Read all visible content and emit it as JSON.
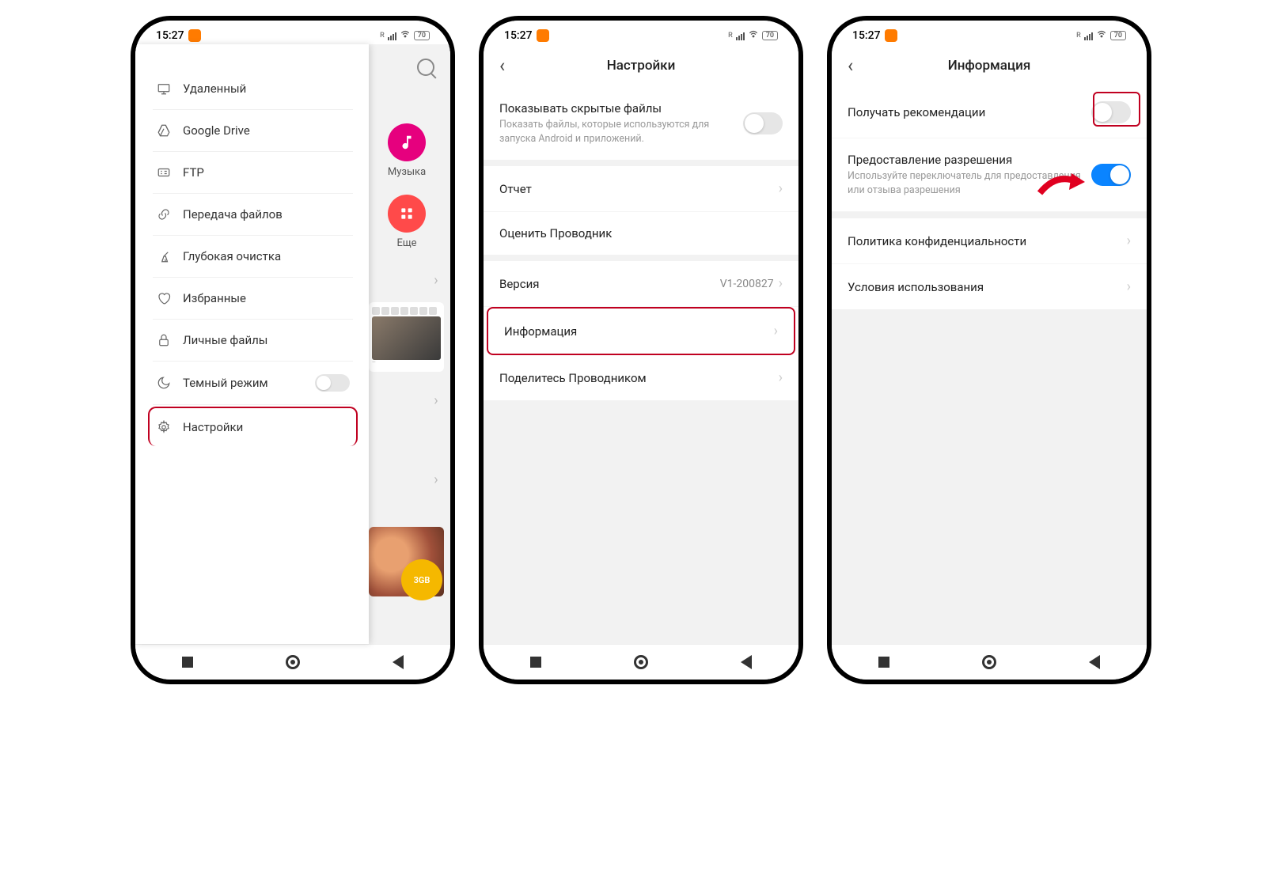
{
  "status": {
    "time": "15:27",
    "battery": "70"
  },
  "phone1": {
    "drawer": {
      "remote": "Удаленный",
      "gdrive": "Google Drive",
      "ftp": "FTP",
      "transfer": "Передача файлов",
      "clean": "Глубокая очистка",
      "favorites": "Избранные",
      "private": "Личные файлы",
      "dark": "Темный режим",
      "settings": "Настройки"
    },
    "tiles": {
      "music": "Музыка",
      "more": "Еще"
    },
    "fab": "3GB"
  },
  "phone2": {
    "title": "Настройки",
    "hidden": {
      "title": "Показывать скрытые файлы",
      "sub": "Показать файлы, которые используются для запуска Android и приложений."
    },
    "report": "Отчет",
    "rate": "Оценить Проводник",
    "version": {
      "label": "Версия",
      "value": "V1-200827"
    },
    "info": "Информация",
    "share": "Поделитесь Проводником"
  },
  "phone3": {
    "title": "Информация",
    "rec": "Получать рекомендации",
    "perm": {
      "title": "Предоставление разрешения",
      "sub": "Используйте переключатель для предоставления или отзыва разрешения"
    },
    "privacy": "Политика конфиденциальности",
    "terms": "Условия использования"
  }
}
